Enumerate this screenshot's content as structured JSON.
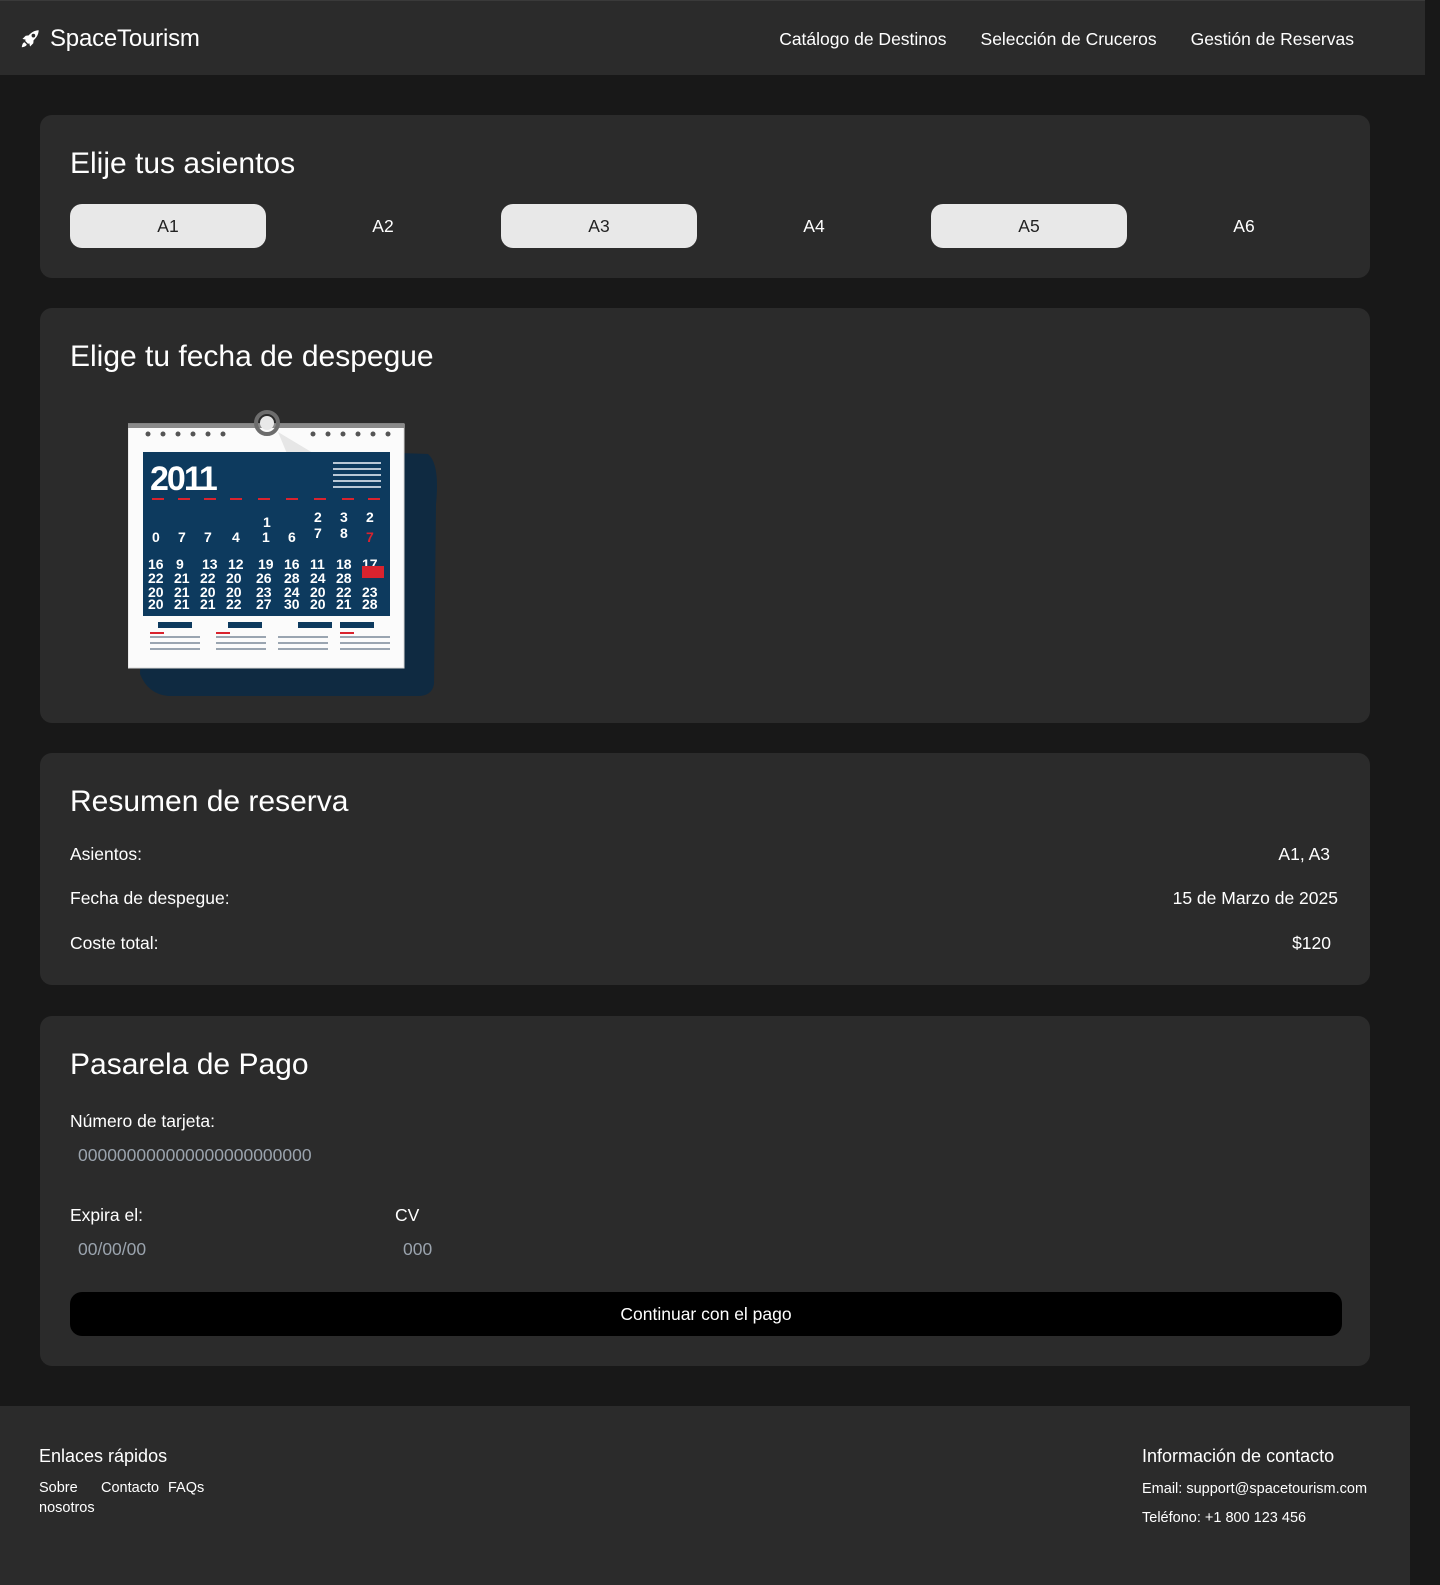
{
  "header": {
    "brand": "SpaceTourism",
    "nav": [
      {
        "label": "Catálogo de Destinos"
      },
      {
        "label": "Selección de Cruceros"
      },
      {
        "label": "Gestión de Reservas"
      }
    ]
  },
  "seats": {
    "title": "Elije tus asientos",
    "items": [
      {
        "label": "A1",
        "style": "light"
      },
      {
        "label": "A2",
        "style": "dark"
      },
      {
        "label": "A3",
        "style": "light"
      },
      {
        "label": "A4",
        "style": "dark"
      },
      {
        "label": "A5",
        "style": "light"
      },
      {
        "label": "A6",
        "style": "dark"
      }
    ]
  },
  "date": {
    "title": "Elige tu fecha de despegue",
    "calendar_year": "2011"
  },
  "summary": {
    "title": "Resumen de reserva",
    "seats_label": "Asientos:",
    "seats_value": "A1, A3",
    "date_label": "Fecha de despegue:",
    "date_value": "15 de Marzo de 2025",
    "cost_label": "Coste total:",
    "cost_value": "$120"
  },
  "payment": {
    "title": "Pasarela de Pago",
    "card_label": "Número de tarjeta:",
    "card_placeholder": "000000000000000000000000",
    "expiry_label": "Expira el:",
    "expiry_placeholder": "00/00/00",
    "cv_label": "CV",
    "cv_placeholder": "000",
    "submit_label": "Continuar con el pago"
  },
  "footer": {
    "quick_links_title": "Enlaces rápidos",
    "links": [
      {
        "label": "Sobre nosotros"
      },
      {
        "label": "Contacto"
      },
      {
        "label": "FAQs"
      }
    ],
    "contact_title": "Información de contacto",
    "email": "Email: support@spacetourism.com",
    "phone": "Teléfono: +1 800 123 456"
  },
  "colors": {
    "page_bg": "#181818",
    "card_bg": "#2b2b2b",
    "seat_selected_bg": "#e8e8e8",
    "button_bg": "#000000",
    "calendar_blue": "#0d3a5e",
    "calendar_red": "#d9232e"
  }
}
